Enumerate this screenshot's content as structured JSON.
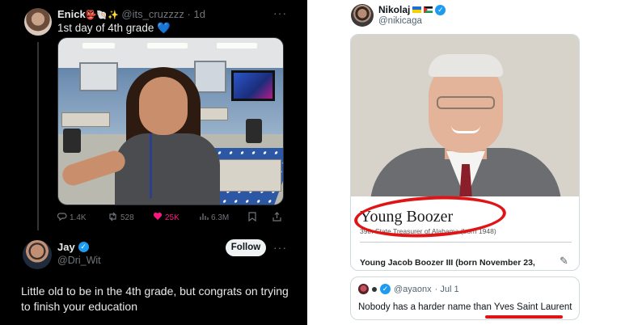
{
  "left_tweet": {
    "author_name": "Enick",
    "author_emoji": "👺🐚✨",
    "handle": "@its_cruzzzz",
    "time": "· 1d",
    "text": "1st day of 4th grade",
    "text_emoji": "💙",
    "more": "···",
    "actions": {
      "replies": "1.4K",
      "retweets": "528",
      "likes": "25K",
      "views": "6.3M"
    }
  },
  "reply": {
    "author_name": "Jay",
    "handle": "@Dri_Wit",
    "follow_label": "Follow",
    "more": "···",
    "text": "Little old to be in the 4th grade, but congrats on trying to finish your education"
  },
  "right_tweet": {
    "author_name": "Nikolaj",
    "handle": "@nikicaga",
    "card": {
      "title": "Young Boozer",
      "subtitle": "39th State Treasurer of Alabama (born 1948)",
      "line": "Young Jacob Boozer III (born November 23,"
    },
    "quote": {
      "handle": "@ayaonx",
      "time": "· Jul 1",
      "text": "Nobody has a harder name than Yves Saint Laurent"
    }
  },
  "colors": {
    "verified_blue": "#1d9bf0",
    "like_pink": "#f91880",
    "annotation_red": "#e01414"
  },
  "icons": [
    "reply-icon",
    "retweet-icon",
    "heart-icon",
    "views-icon",
    "bookmark-icon",
    "share-icon",
    "verified-icon",
    "edit-pencil-icon"
  ]
}
